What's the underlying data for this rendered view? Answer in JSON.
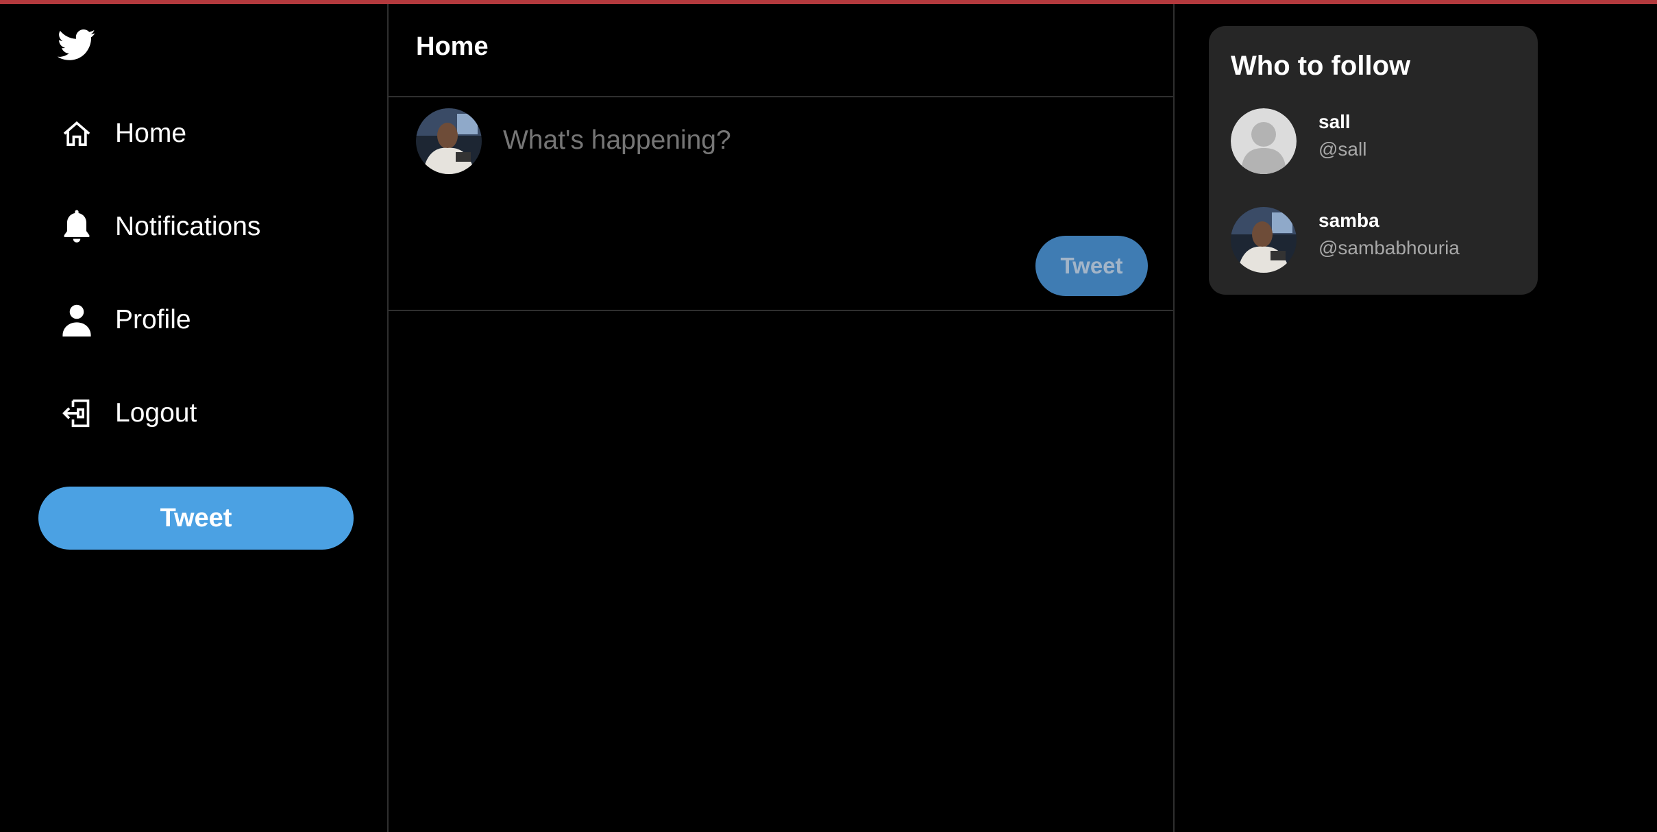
{
  "sidebar": {
    "logo_icon": "twitter-bird-icon",
    "items": [
      {
        "label": "Home",
        "icon": "home-icon"
      },
      {
        "label": "Notifications",
        "icon": "bell-icon"
      },
      {
        "label": "Profile",
        "icon": "user-icon"
      },
      {
        "label": "Logout",
        "icon": "logout-icon"
      }
    ],
    "tweet_label": "Tweet"
  },
  "main": {
    "title": "Home",
    "composer": {
      "placeholder": "What's happening?",
      "tweet_label": "Tweet"
    }
  },
  "who_to_follow": {
    "title": "Who to follow",
    "users": [
      {
        "name": "sall",
        "handle": "@sall",
        "avatar": "default-avatar"
      },
      {
        "name": "samba",
        "handle": "@sambabhouria",
        "avatar": "photo-avatar"
      }
    ]
  },
  "colors": {
    "background": "#000000",
    "accent": "#4ba1e3",
    "card": "#262626",
    "divider": "#2f2f2f",
    "top_border": "#b3393d"
  }
}
